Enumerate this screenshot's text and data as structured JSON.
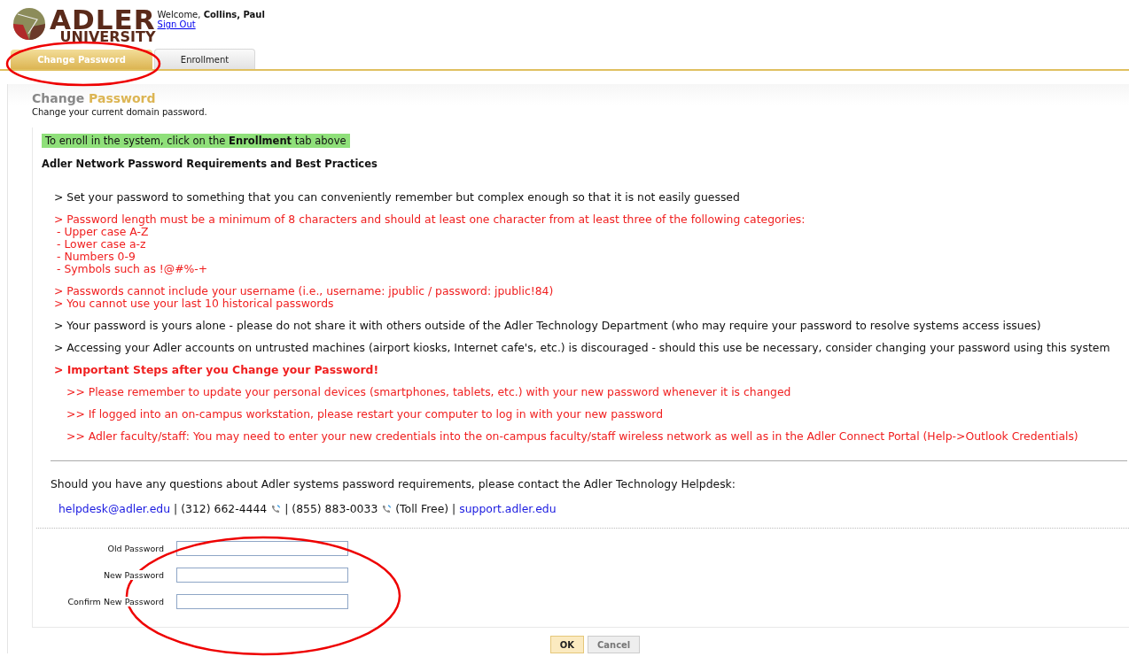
{
  "header": {
    "logo_top": "ADLER",
    "logo_bottom": "UNIVERSITY",
    "welcome": "Welcome, **Collins, Paul**",
    "sign_out": "Sign Out"
  },
  "tabs": [
    {
      "label": "Change Password",
      "selected": true,
      "circled": true
    },
    {
      "label": "Enrollment",
      "selected": false,
      "circled": false
    }
  ],
  "page": {
    "title_plain": "Change",
    "title_accent": "Password",
    "subtitle": "Change your current domain password."
  },
  "notice": "To enroll in the system, click on the **Enrollment** tab above",
  "heading": "Adler Network Password Requirements and Best Practices",
  "rules": [
    {
      "kind": "note",
      "text": "> Set your password to something that you can conveniently remember but complex enough so that it is not easily guessed"
    },
    {
      "kind": "warning",
      "text": "> Password length must be a minimum of 8 characters and should at least one character from at least three of the following categories:",
      "details": [
        "- Upper case A-Z",
        "- Lower case a-z",
        "- Numbers 0-9",
        "- Symbols such as !@#%-+"
      ]
    },
    {
      "kind": "warning",
      "text": "> Passwords cannot include your username (i.e., username:  jpublic / password:  jpublic!84)",
      "details": [
        "> You cannot use your last 10 historical passwords"
      ]
    },
    {
      "kind": "note",
      "text": "> Your password is yours alone - please do not share it with others outside of the Adler Technology Department (who may require your password to resolve systems access issues)"
    },
    {
      "kind": "note",
      "text": "> Accessing your Adler accounts on untrusted machines (airport kiosks, Internet cafe's, etc.) is discouraged - should this use be necessary, consider changing your password using this system"
    },
    {
      "kind": "important",
      "text": "> Important Steps after you Change your Password!"
    },
    {
      "kind": "step",
      "text": ">> Please remember to update your personal devices (smartphones, tablets, etc.) with your new password whenever it is changed"
    },
    {
      "kind": "step",
      "text": ">> If logged into an on-campus workstation, please restart your computer to log in with your new password"
    },
    {
      "kind": "step",
      "text": ">> Adler faculty/staff:  You may need to enter your new credentials into the on-campus faculty/staff wireless network as well as in the Adler Connect Portal (Help->Outlook Credentials)"
    }
  ],
  "contact_intro": "Should you have any questions about Adler systems password requirements, please contact the Adler Technology Helpdesk:",
  "contacts": [
    {
      "kind": "link",
      "text": "helpdesk@adler.edu"
    },
    {
      "kind": "text",
      "text": "|"
    },
    {
      "kind": "phone",
      "text": "(312) 662-4444"
    },
    {
      "kind": "text",
      "text": "|"
    },
    {
      "kind": "phone",
      "text": "(855) 883-0033"
    },
    {
      "kind": "text",
      "text": "(Toll Free)"
    },
    {
      "kind": "text",
      "text": "|"
    },
    {
      "kind": "link",
      "text": "support.adler.edu"
    }
  ],
  "fields": [
    {
      "label": "Old Password"
    },
    {
      "label": "New Password"
    },
    {
      "label": "Confirm New Password"
    }
  ],
  "form_circled": true,
  "buttons": [
    {
      "label": "OK",
      "kind": "primary"
    },
    {
      "label": "Cancel",
      "kind": "secondary"
    }
  ]
}
